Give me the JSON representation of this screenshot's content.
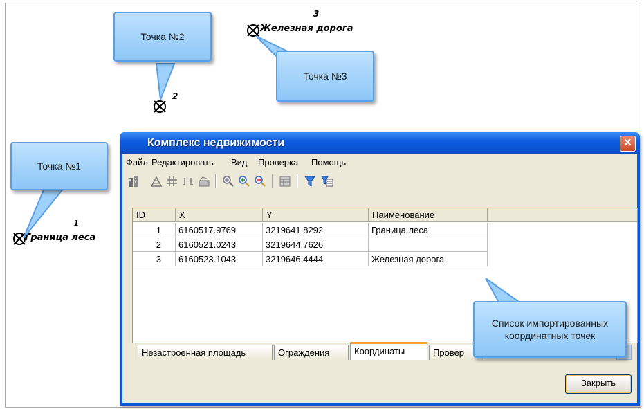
{
  "map": {
    "points": [
      {
        "num": "1",
        "name": "Граница леса"
      },
      {
        "num": "2",
        "name": ""
      },
      {
        "num": "3",
        "name": "Железная дорога"
      }
    ]
  },
  "callouts": {
    "point1": "Точка №1",
    "point2": "Точка №2",
    "point3": "Точка №3",
    "list": "Список импортированных координатных точек"
  },
  "window": {
    "title": "Комплекс недвижимости",
    "close_glyph": "✕",
    "menu": [
      "Файл",
      "Редактировать",
      "Вид",
      "Проверка",
      "Помощь"
    ],
    "toolbar_icons": [
      "building-icon",
      "fence-icon",
      "grid-icon",
      "split-icon",
      "area-icon",
      "zoom-extent-icon",
      "zoom-in-icon",
      "zoom-out-icon",
      "table-icon",
      "filter-icon",
      "filter-settings-icon"
    ]
  },
  "table": {
    "columns": [
      "ID",
      "X",
      "Y",
      "Наименование"
    ],
    "rows": [
      {
        "id": "1",
        "x": "6160517.9769",
        "y": "3219641.8292",
        "name": "Граница леса"
      },
      {
        "id": "2",
        "x": "6160521.0243",
        "y": "3219644.7626",
        "name": ""
      },
      {
        "id": "3",
        "x": "6160523.1043",
        "y": "3219646.4444",
        "name": "Железная дорога"
      }
    ]
  },
  "tabs": [
    "Незастроенная площадь",
    "Ограждения",
    "Координаты",
    "Провер"
  ],
  "active_tab": "Координаты",
  "buttons": {
    "close": "Закрыть"
  },
  "colors": {
    "titlebar": "#0a55d4",
    "callout": "#8cc6f6",
    "active_tab": "#f3a43a"
  }
}
